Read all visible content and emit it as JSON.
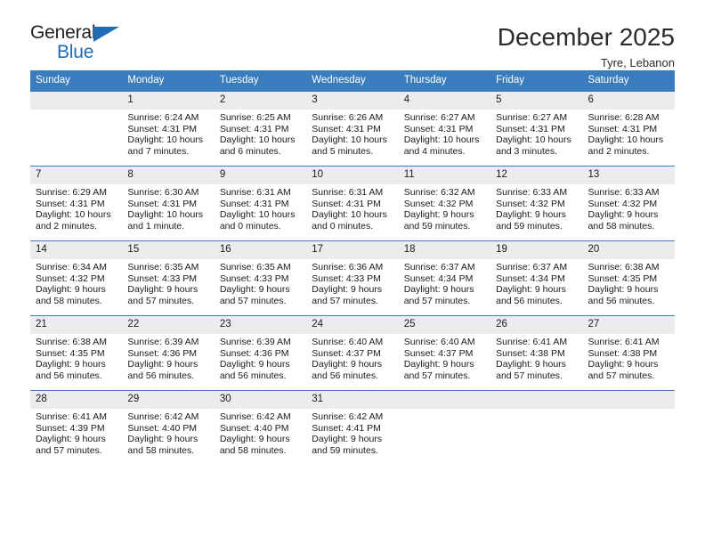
{
  "brand": {
    "name_top": "General",
    "name_bottom": "Blue",
    "accent_color": "#1f6cb4"
  },
  "header": {
    "month_title": "December 2025",
    "location": "Tyre, Lebanon"
  },
  "theme": {
    "header_row_bg": "#3a7dbf",
    "daynum_bg": "#ececec",
    "text_color": "#1a1a1a"
  },
  "weekday_headers": [
    "Sunday",
    "Monday",
    "Tuesday",
    "Wednesday",
    "Thursday",
    "Friday",
    "Saturday"
  ],
  "weeks": [
    [
      {
        "day": "",
        "lines": []
      },
      {
        "day": "1",
        "lines": [
          "Sunrise: 6:24 AM",
          "Sunset: 4:31 PM",
          "Daylight: 10 hours",
          "and 7 minutes."
        ]
      },
      {
        "day": "2",
        "lines": [
          "Sunrise: 6:25 AM",
          "Sunset: 4:31 PM",
          "Daylight: 10 hours",
          "and 6 minutes."
        ]
      },
      {
        "day": "3",
        "lines": [
          "Sunrise: 6:26 AM",
          "Sunset: 4:31 PM",
          "Daylight: 10 hours",
          "and 5 minutes."
        ]
      },
      {
        "day": "4",
        "lines": [
          "Sunrise: 6:27 AM",
          "Sunset: 4:31 PM",
          "Daylight: 10 hours",
          "and 4 minutes."
        ]
      },
      {
        "day": "5",
        "lines": [
          "Sunrise: 6:27 AM",
          "Sunset: 4:31 PM",
          "Daylight: 10 hours",
          "and 3 minutes."
        ]
      },
      {
        "day": "6",
        "lines": [
          "Sunrise: 6:28 AM",
          "Sunset: 4:31 PM",
          "Daylight: 10 hours",
          "and 2 minutes."
        ]
      }
    ],
    [
      {
        "day": "7",
        "lines": [
          "Sunrise: 6:29 AM",
          "Sunset: 4:31 PM",
          "Daylight: 10 hours",
          "and 2 minutes."
        ]
      },
      {
        "day": "8",
        "lines": [
          "Sunrise: 6:30 AM",
          "Sunset: 4:31 PM",
          "Daylight: 10 hours",
          "and 1 minute."
        ]
      },
      {
        "day": "9",
        "lines": [
          "Sunrise: 6:31 AM",
          "Sunset: 4:31 PM",
          "Daylight: 10 hours",
          "and 0 minutes."
        ]
      },
      {
        "day": "10",
        "lines": [
          "Sunrise: 6:31 AM",
          "Sunset: 4:31 PM",
          "Daylight: 10 hours",
          "and 0 minutes."
        ]
      },
      {
        "day": "11",
        "lines": [
          "Sunrise: 6:32 AM",
          "Sunset: 4:32 PM",
          "Daylight: 9 hours",
          "and 59 minutes."
        ]
      },
      {
        "day": "12",
        "lines": [
          "Sunrise: 6:33 AM",
          "Sunset: 4:32 PM",
          "Daylight: 9 hours",
          "and 59 minutes."
        ]
      },
      {
        "day": "13",
        "lines": [
          "Sunrise: 6:33 AM",
          "Sunset: 4:32 PM",
          "Daylight: 9 hours",
          "and 58 minutes."
        ]
      }
    ],
    [
      {
        "day": "14",
        "lines": [
          "Sunrise: 6:34 AM",
          "Sunset: 4:32 PM",
          "Daylight: 9 hours",
          "and 58 minutes."
        ]
      },
      {
        "day": "15",
        "lines": [
          "Sunrise: 6:35 AM",
          "Sunset: 4:33 PM",
          "Daylight: 9 hours",
          "and 57 minutes."
        ]
      },
      {
        "day": "16",
        "lines": [
          "Sunrise: 6:35 AM",
          "Sunset: 4:33 PM",
          "Daylight: 9 hours",
          "and 57 minutes."
        ]
      },
      {
        "day": "17",
        "lines": [
          "Sunrise: 6:36 AM",
          "Sunset: 4:33 PM",
          "Daylight: 9 hours",
          "and 57 minutes."
        ]
      },
      {
        "day": "18",
        "lines": [
          "Sunrise: 6:37 AM",
          "Sunset: 4:34 PM",
          "Daylight: 9 hours",
          "and 57 minutes."
        ]
      },
      {
        "day": "19",
        "lines": [
          "Sunrise: 6:37 AM",
          "Sunset: 4:34 PM",
          "Daylight: 9 hours",
          "and 56 minutes."
        ]
      },
      {
        "day": "20",
        "lines": [
          "Sunrise: 6:38 AM",
          "Sunset: 4:35 PM",
          "Daylight: 9 hours",
          "and 56 minutes."
        ]
      }
    ],
    [
      {
        "day": "21",
        "lines": [
          "Sunrise: 6:38 AM",
          "Sunset: 4:35 PM",
          "Daylight: 9 hours",
          "and 56 minutes."
        ]
      },
      {
        "day": "22",
        "lines": [
          "Sunrise: 6:39 AM",
          "Sunset: 4:36 PM",
          "Daylight: 9 hours",
          "and 56 minutes."
        ]
      },
      {
        "day": "23",
        "lines": [
          "Sunrise: 6:39 AM",
          "Sunset: 4:36 PM",
          "Daylight: 9 hours",
          "and 56 minutes."
        ]
      },
      {
        "day": "24",
        "lines": [
          "Sunrise: 6:40 AM",
          "Sunset: 4:37 PM",
          "Daylight: 9 hours",
          "and 56 minutes."
        ]
      },
      {
        "day": "25",
        "lines": [
          "Sunrise: 6:40 AM",
          "Sunset: 4:37 PM",
          "Daylight: 9 hours",
          "and 57 minutes."
        ]
      },
      {
        "day": "26",
        "lines": [
          "Sunrise: 6:41 AM",
          "Sunset: 4:38 PM",
          "Daylight: 9 hours",
          "and 57 minutes."
        ]
      },
      {
        "day": "27",
        "lines": [
          "Sunrise: 6:41 AM",
          "Sunset: 4:38 PM",
          "Daylight: 9 hours",
          "and 57 minutes."
        ]
      }
    ],
    [
      {
        "day": "28",
        "lines": [
          "Sunrise: 6:41 AM",
          "Sunset: 4:39 PM",
          "Daylight: 9 hours",
          "and 57 minutes."
        ]
      },
      {
        "day": "29",
        "lines": [
          "Sunrise: 6:42 AM",
          "Sunset: 4:40 PM",
          "Daylight: 9 hours",
          "and 58 minutes."
        ]
      },
      {
        "day": "30",
        "lines": [
          "Sunrise: 6:42 AM",
          "Sunset: 4:40 PM",
          "Daylight: 9 hours",
          "and 58 minutes."
        ]
      },
      {
        "day": "31",
        "lines": [
          "Sunrise: 6:42 AM",
          "Sunset: 4:41 PM",
          "Daylight: 9 hours",
          "and 59 minutes."
        ]
      },
      {
        "day": "",
        "lines": []
      },
      {
        "day": "",
        "lines": []
      },
      {
        "day": "",
        "lines": []
      }
    ]
  ]
}
